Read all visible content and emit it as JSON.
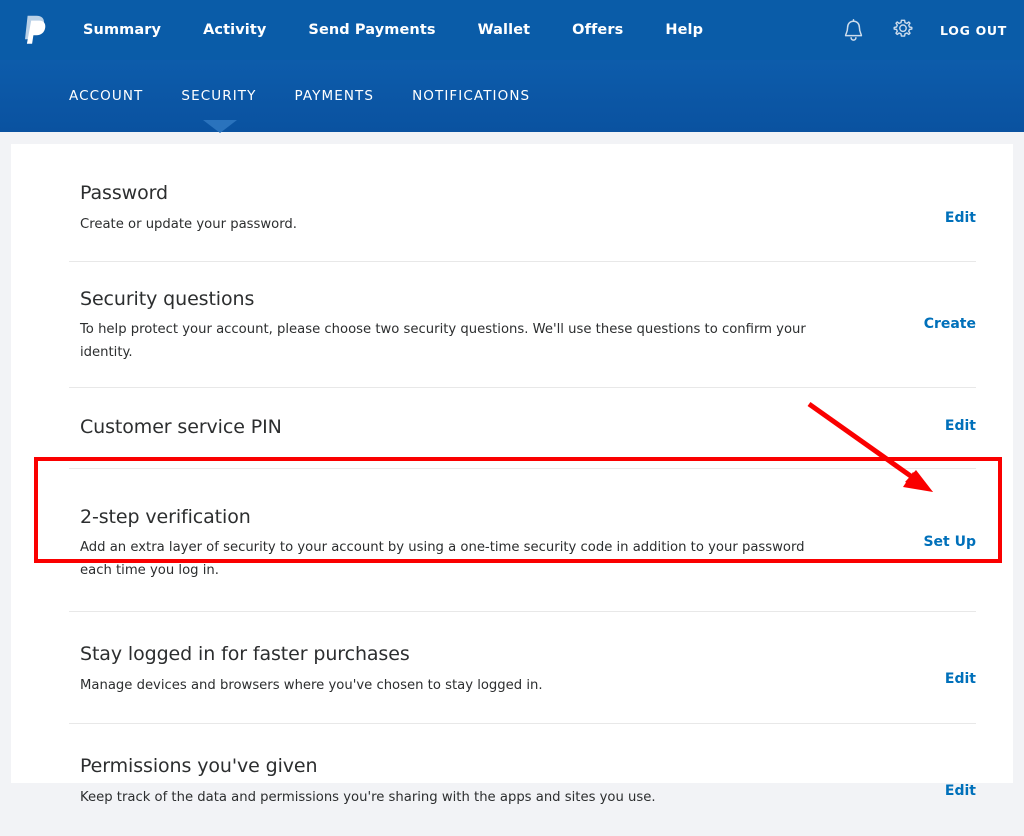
{
  "brand": {
    "logo_icon": "paypal-logo",
    "accent_link_color": "#0070ba",
    "nav_color": "#0a5ca8",
    "annotation_color": "#fa0000"
  },
  "topnav": {
    "links": [
      {
        "label": "Summary"
      },
      {
        "label": "Activity"
      },
      {
        "label": "Send Payments"
      },
      {
        "label": "Wallet"
      },
      {
        "label": "Offers"
      },
      {
        "label": "Help"
      }
    ],
    "notifications_icon": "bell-icon",
    "settings_icon": "gear-icon",
    "logout_label": "LOG OUT"
  },
  "subnav": {
    "items": [
      {
        "label": "ACCOUNT",
        "active": false
      },
      {
        "label": "SECURITY",
        "active": true
      },
      {
        "label": "PAYMENTS",
        "active": false
      },
      {
        "label": "NOTIFICATIONS",
        "active": false
      }
    ]
  },
  "settings": {
    "rows": [
      {
        "title": "Password",
        "description": "Create or update your password.",
        "action": "Edit"
      },
      {
        "title": "Security questions",
        "description": "To help protect your account, please choose two security questions. We'll use these questions to confirm your identity.",
        "action": "Create"
      },
      {
        "title": "Customer service PIN",
        "description": "",
        "action": "Edit"
      },
      {
        "title": "2-step verification",
        "description": "Add an extra layer of security to your account by using a one-time security code in addition to your password each time you log in.",
        "action": "Set Up"
      },
      {
        "title": "Stay logged in for faster purchases",
        "description": "Manage devices and browsers where you've chosen to stay logged in.",
        "action": "Edit"
      },
      {
        "title": "Permissions you've given",
        "description": "Keep track of the data and permissions you're sharing with the apps and sites you use.",
        "action": "Edit"
      }
    ]
  },
  "annotations": {
    "highlight_target": "2-step verification",
    "arrow_target": "Set Up",
    "arrow_icon": "red-arrow-icon",
    "box_icon": "red-rectangle-highlight"
  }
}
